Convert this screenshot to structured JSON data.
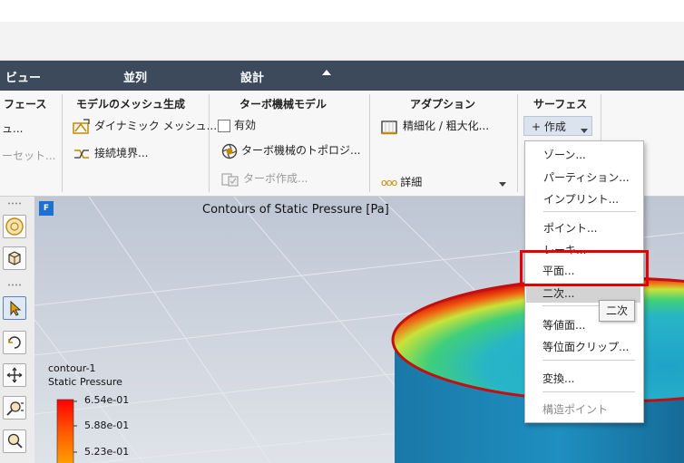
{
  "menubar": {
    "items": [
      "ビュー",
      "並列",
      "設計"
    ]
  },
  "ribbon": {
    "groups": {
      "surface_prev": {
        "title": "フェース",
        "items": [
          "ュ...",
          "ーセット..."
        ]
      },
      "mesh": {
        "title": "モデルのメッシュ生成",
        "dynamic_mesh": "ダイナミック メッシュ...",
        "interface": "接続境界..."
      },
      "turbo": {
        "title": "ターボ機械モデル",
        "enable": "有効",
        "topology": "ターボ機械のトポロジ...",
        "create": "ターボ作成..."
      },
      "adaption": {
        "title": "アダプション",
        "refine": "精細化 / 粗大化...",
        "detail": "詳細"
      },
      "surface": {
        "title": "サーフェス",
        "create": "+ 作成"
      }
    }
  },
  "graphics": {
    "title": "Contours of Static Pressure [Pa]",
    "legend": {
      "name": "contour-1",
      "field": "Static Pressure",
      "ticks": [
        "6.54e-01",
        "5.88e-01",
        "5.23e-01"
      ]
    },
    "badge": "F"
  },
  "dropdown": {
    "items": [
      "ゾーン...",
      "パーティション...",
      "インプリント...",
      "ポイント...",
      "レーキ...",
      "平面...",
      "二次...",
      "等値面...",
      "等位面クリップ...",
      "変換...",
      "構造ポイント"
    ]
  },
  "tooltip": "二次",
  "colors": {
    "menubar": "#3c4a5c",
    "highlight_box": "#e60000",
    "accent_badge": "#1f6fd1"
  }
}
